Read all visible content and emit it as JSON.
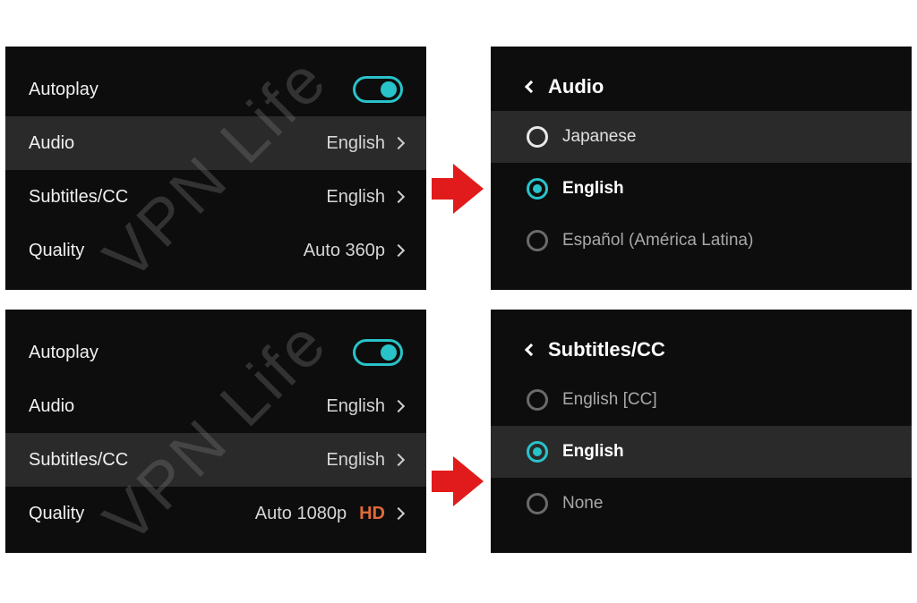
{
  "watermark": "VPN Life",
  "left_panels": [
    {
      "highlight_index": 1,
      "rows": [
        {
          "label": "Autoplay",
          "type": "toggle",
          "toggle_on": true
        },
        {
          "label": "Audio",
          "type": "nav",
          "value": "English"
        },
        {
          "label": "Subtitles/CC",
          "type": "nav",
          "value": "English"
        },
        {
          "label": "Quality",
          "type": "nav",
          "value": "Auto 360p"
        }
      ]
    },
    {
      "highlight_index": 2,
      "rows": [
        {
          "label": "Autoplay",
          "type": "toggle",
          "toggle_on": true
        },
        {
          "label": "Audio",
          "type": "nav",
          "value": "English"
        },
        {
          "label": "Subtitles/CC",
          "type": "nav",
          "value": "English"
        },
        {
          "label": "Quality",
          "type": "nav",
          "value": "Auto 1080p",
          "hd": "HD"
        }
      ]
    }
  ],
  "right_panels": [
    {
      "title": "Audio",
      "highlight_index": 0,
      "selected_index": 1,
      "options": [
        {
          "label": "Japanese"
        },
        {
          "label": "English"
        },
        {
          "label": "Español (América Latina)"
        }
      ]
    },
    {
      "title": "Subtitles/CC",
      "highlight_index": 1,
      "selected_index": 1,
      "options": [
        {
          "label": "English [CC]"
        },
        {
          "label": "English"
        },
        {
          "label": "None"
        }
      ]
    }
  ]
}
